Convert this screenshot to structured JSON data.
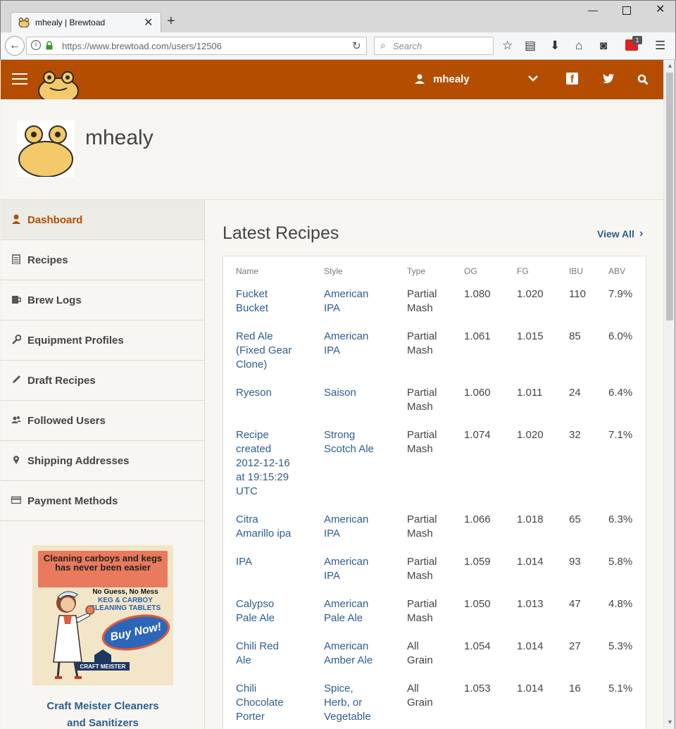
{
  "browser": {
    "tab_title": "mhealy | Brewtoad",
    "url": "https://www.brewtoad.com/users/12506",
    "search_placeholder": "Search",
    "extension_badge": "1"
  },
  "header": {
    "username": "mhealy"
  },
  "profile": {
    "name": "mhealy"
  },
  "sidebar": {
    "items": [
      {
        "label": "Dashboard",
        "icon": "user-icon",
        "active": true
      },
      {
        "label": "Recipes",
        "icon": "clipboard-icon"
      },
      {
        "label": "Brew Logs",
        "icon": "mug-icon"
      },
      {
        "label": "Equipment Profiles",
        "icon": "wrench-icon"
      },
      {
        "label": "Draft Recipes",
        "icon": "pencil-icon"
      },
      {
        "label": "Followed Users",
        "icon": "users-icon"
      },
      {
        "label": "Shipping Addresses",
        "icon": "map-pin-icon"
      },
      {
        "label": "Payment Methods",
        "icon": "credit-card-icon"
      }
    ],
    "ad": {
      "headline": "Cleaning carboys and kegs has never been easier",
      "sub1": "No Guess, No Mess",
      "sub2": "KEG & CARBOY CLEANING TABLETS",
      "buy": "Buy Now!",
      "brand": "CRAFT MEISTER",
      "caption_line1": "Craft Meister Cleaners",
      "caption_line2": "and Sanitizers"
    }
  },
  "main": {
    "title": "Latest Recipes",
    "view_all": "View All",
    "columns": [
      "Name",
      "Style",
      "Type",
      "OG",
      "FG",
      "IBU",
      "ABV"
    ],
    "recipes": [
      {
        "name": [
          "Fucket",
          "Bucket"
        ],
        "style": [
          "American",
          "IPA"
        ],
        "type": [
          "Partial",
          "Mash"
        ],
        "og": "1.080",
        "fg": "1.020",
        "ibu": "110",
        "abv": "7.9%"
      },
      {
        "name": [
          "Red Ale",
          "(Fixed Gear",
          "Clone)"
        ],
        "style": [
          "American",
          "IPA"
        ],
        "type": [
          "Partial",
          "Mash"
        ],
        "og": "1.061",
        "fg": "1.015",
        "ibu": "85",
        "abv": "6.0%"
      },
      {
        "name": [
          "Ryeson"
        ],
        "style": [
          "Saison"
        ],
        "type": [
          "Partial",
          "Mash"
        ],
        "og": "1.060",
        "fg": "1.011",
        "ibu": "24",
        "abv": "6.4%"
      },
      {
        "name": [
          "Recipe",
          "created",
          "2012-12-16",
          "at 19:15:29",
          "UTC"
        ],
        "style": [
          "Strong",
          "Scotch Ale"
        ],
        "type": [
          "Partial",
          "Mash"
        ],
        "og": "1.074",
        "fg": "1.020",
        "ibu": "32",
        "abv": "7.1%"
      },
      {
        "name": [
          "Citra",
          "Amarillo ipa"
        ],
        "style": [
          "American",
          "IPA"
        ],
        "type": [
          "Partial",
          "Mash"
        ],
        "og": "1.066",
        "fg": "1.018",
        "ibu": "65",
        "abv": "6.3%"
      },
      {
        "name": [
          "IPA"
        ],
        "style": [
          "American",
          "IPA"
        ],
        "type": [
          "Partial",
          "Mash"
        ],
        "og": "1.059",
        "fg": "1.014",
        "ibu": "93",
        "abv": "5.8%"
      },
      {
        "name": [
          "Calypso",
          "Pale Ale"
        ],
        "style": [
          "American",
          "Pale Ale"
        ],
        "type": [
          "Partial",
          "Mash"
        ],
        "og": "1.050",
        "fg": "1.013",
        "ibu": "47",
        "abv": "4.8%"
      },
      {
        "name": [
          "Chili Red",
          "Ale"
        ],
        "style": [
          "American",
          "Amber Ale"
        ],
        "type": [
          "All",
          "Grain"
        ],
        "og": "1.054",
        "fg": "1.014",
        "ibu": "27",
        "abv": "5.3%"
      },
      {
        "name": [
          "Chili",
          "Chocolate",
          "Porter"
        ],
        "style": [
          "Spice,",
          "Herb, or",
          "Vegetable"
        ],
        "type": [
          "All",
          "Grain"
        ],
        "og": "1.053",
        "fg": "1.014",
        "ibu": "16",
        "abv": "5.1%"
      }
    ]
  },
  "colors": {
    "brand": "#b54d00",
    "link": "#2e5d8f"
  }
}
